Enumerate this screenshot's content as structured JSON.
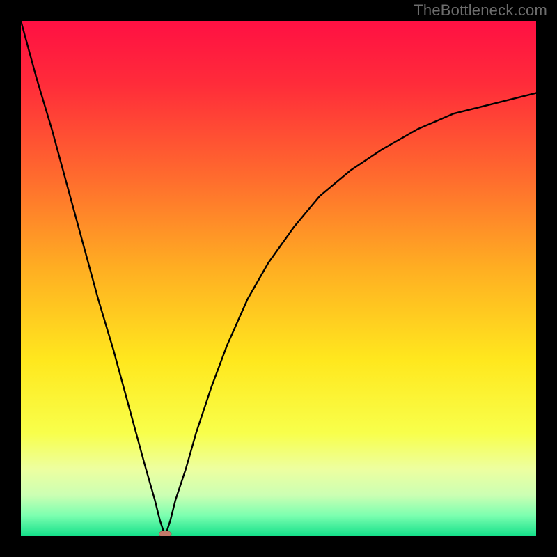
{
  "watermark": "TheBottleneck.com",
  "colors": {
    "frame": "#000000",
    "curve": "#000000",
    "marker_fill": "#c47a6a",
    "marker_stroke": "#8a4a3f",
    "gradient_stops": [
      {
        "offset": 0.0,
        "color": "#ff1043"
      },
      {
        "offset": 0.12,
        "color": "#ff2b3a"
      },
      {
        "offset": 0.3,
        "color": "#ff6a2e"
      },
      {
        "offset": 0.48,
        "color": "#ffae22"
      },
      {
        "offset": 0.66,
        "color": "#ffe81e"
      },
      {
        "offset": 0.8,
        "color": "#f8ff4b"
      },
      {
        "offset": 0.87,
        "color": "#edffa0"
      },
      {
        "offset": 0.92,
        "color": "#ccffb3"
      },
      {
        "offset": 0.96,
        "color": "#7cffb0"
      },
      {
        "offset": 1.0,
        "color": "#14e08a"
      }
    ]
  },
  "chart_data": {
    "type": "line",
    "title": "",
    "xlabel": "",
    "ylabel": "",
    "xlim": [
      0,
      100
    ],
    "ylim": [
      0,
      100
    ],
    "grid": false,
    "legend": false,
    "min_point": {
      "x": 28,
      "y": 0
    },
    "series": [
      {
        "name": "bottleneck-curve",
        "points": [
          {
            "x": 0,
            "y": 100
          },
          {
            "x": 3,
            "y": 89
          },
          {
            "x": 6,
            "y": 79
          },
          {
            "x": 9,
            "y": 68
          },
          {
            "x": 12,
            "y": 57
          },
          {
            "x": 15,
            "y": 46
          },
          {
            "x": 18,
            "y": 36
          },
          {
            "x": 21,
            "y": 25
          },
          {
            "x": 24,
            "y": 14
          },
          {
            "x": 26,
            "y": 7
          },
          {
            "x": 27,
            "y": 3
          },
          {
            "x": 28,
            "y": 0
          },
          {
            "x": 29,
            "y": 3
          },
          {
            "x": 30,
            "y": 7
          },
          {
            "x": 32,
            "y": 13
          },
          {
            "x": 34,
            "y": 20
          },
          {
            "x": 37,
            "y": 29
          },
          {
            "x": 40,
            "y": 37
          },
          {
            "x": 44,
            "y": 46
          },
          {
            "x": 48,
            "y": 53
          },
          {
            "x": 53,
            "y": 60
          },
          {
            "x": 58,
            "y": 66
          },
          {
            "x": 64,
            "y": 71
          },
          {
            "x": 70,
            "y": 75
          },
          {
            "x": 77,
            "y": 79
          },
          {
            "x": 84,
            "y": 82
          },
          {
            "x": 92,
            "y": 84
          },
          {
            "x": 100,
            "y": 86
          }
        ]
      }
    ]
  }
}
